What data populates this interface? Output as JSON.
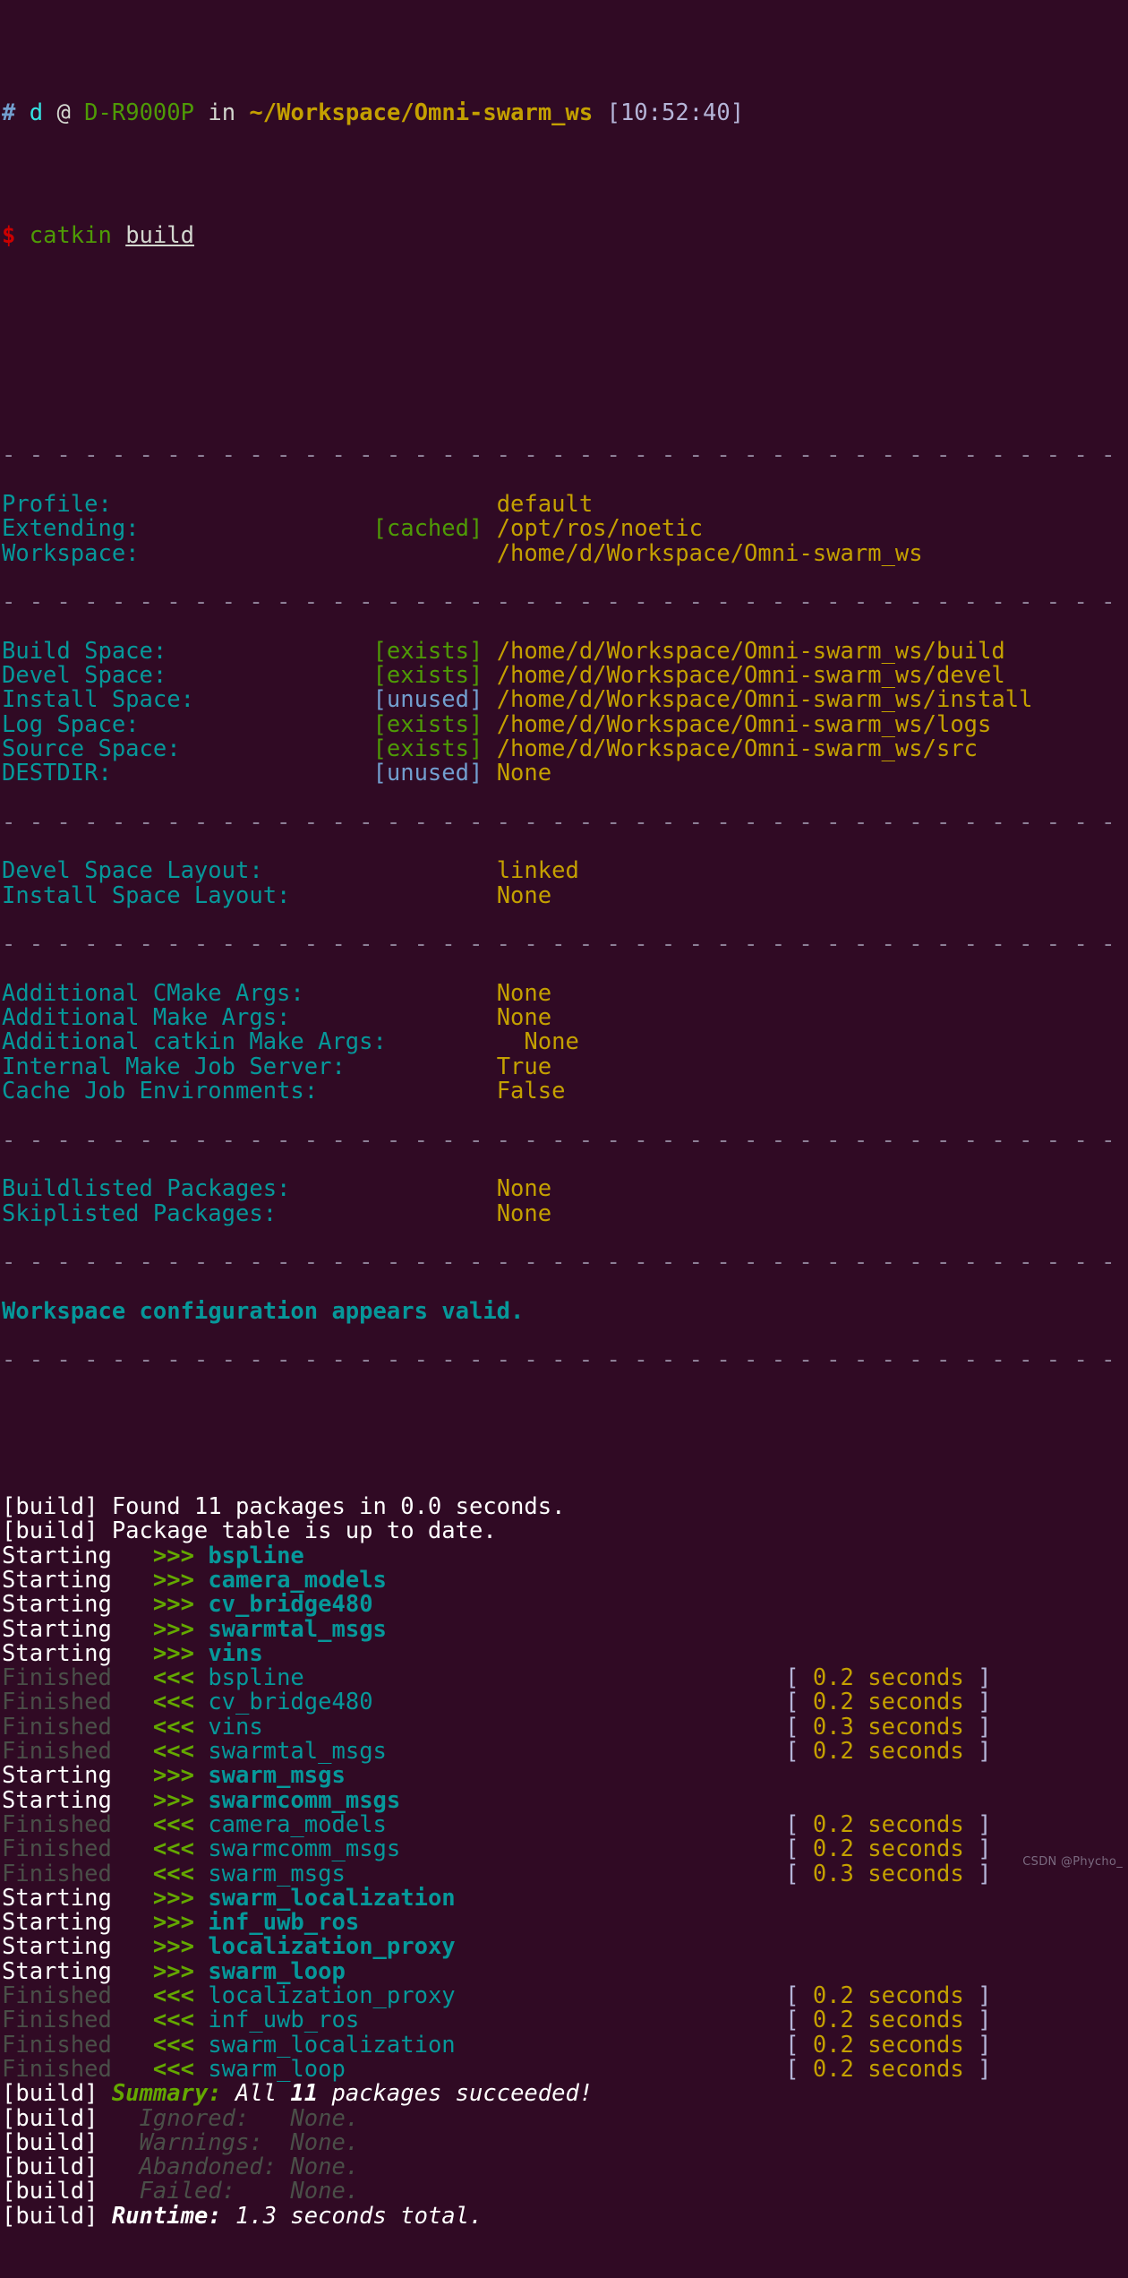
{
  "terminal": {
    "background_color": "#300a24",
    "prompt": {
      "hash": "#",
      "user": "d",
      "at": "@",
      "host": "D-R9000P",
      "in": "in",
      "path": "~/Workspace/Omni-swarm_ws",
      "time": "[10:52:40]",
      "dollar": "$",
      "command": "catkin",
      "argument": "build"
    },
    "separator": "- - - - - - - - - - - - - - - - - - - - - - - - - - - - - - - - - - - - - - - - - - - - - - -",
    "config_groups": [
      {
        "rows": [
          {
            "label": "Profile:",
            "status": "",
            "value": "default"
          },
          {
            "label": "Extending:",
            "status": "[cached]",
            "status_color": "green",
            "value": "/opt/ros/noetic"
          },
          {
            "label": "Workspace:",
            "status": "",
            "value": "/home/d/Workspace/Omni-swarm_ws"
          }
        ]
      },
      {
        "rows": [
          {
            "label": "Build Space:",
            "status": "[exists]",
            "status_color": "green",
            "value": "/home/d/Workspace/Omni-swarm_ws/build"
          },
          {
            "label": "Devel Space:",
            "status": "[exists]",
            "status_color": "green",
            "value": "/home/d/Workspace/Omni-swarm_ws/devel"
          },
          {
            "label": "Install Space:",
            "status": "[unused]",
            "status_color": "blue",
            "value": "/home/d/Workspace/Omni-swarm_ws/install"
          },
          {
            "label": "Log Space:",
            "status": "[exists]",
            "status_color": "green",
            "value": "/home/d/Workspace/Omni-swarm_ws/logs"
          },
          {
            "label": "Source Space:",
            "status": "[exists]",
            "status_color": "green",
            "value": "/home/d/Workspace/Omni-swarm_ws/src"
          },
          {
            "label": "DESTDIR:",
            "status": "[unused]",
            "status_color": "blue",
            "value": "None"
          }
        ]
      },
      {
        "rows": [
          {
            "label": "Devel Space Layout:",
            "status": "",
            "value": "linked"
          },
          {
            "label": "Install Space Layout:",
            "status": "",
            "value": "None"
          }
        ]
      },
      {
        "rows": [
          {
            "label": "Additional CMake Args:",
            "status": "",
            "value": "None"
          },
          {
            "label": "Additional Make Args:",
            "status": "",
            "value": "None"
          },
          {
            "label": "Additional catkin Make Args:",
            "status": "",
            "value": "None"
          },
          {
            "label": "Internal Make Job Server:",
            "status": "",
            "value": "True"
          },
          {
            "label": "Cache Job Environments:",
            "status": "",
            "value": "False"
          }
        ]
      },
      {
        "rows": [
          {
            "label": "Buildlisted Packages:",
            "status": "",
            "value": "None"
          },
          {
            "label": "Skiplisted Packages:",
            "status": "",
            "value": "None"
          }
        ]
      }
    ],
    "valid_message": "Workspace configuration appears valid.",
    "build_lines": [
      {
        "tag": "[build]",
        "text": " Found 11 packages in 0.0 seconds."
      },
      {
        "tag": "[build]",
        "text": " Package table is up to date."
      }
    ],
    "job_lines": [
      {
        "state": "Starting",
        "arrow": ">>>",
        "package": "bspline",
        "time": ""
      },
      {
        "state": "Starting",
        "arrow": ">>>",
        "package": "camera_models",
        "time": ""
      },
      {
        "state": "Starting",
        "arrow": ">>>",
        "package": "cv_bridge480",
        "time": ""
      },
      {
        "state": "Starting",
        "arrow": ">>>",
        "package": "swarmtal_msgs",
        "time": ""
      },
      {
        "state": "Starting",
        "arrow": ">>>",
        "package": "vins",
        "time": ""
      },
      {
        "state": "Finished",
        "arrow": "<<<",
        "package": "bspline",
        "time": "[ 0.2 seconds ]"
      },
      {
        "state": "Finished",
        "arrow": "<<<",
        "package": "cv_bridge480",
        "time": "[ 0.2 seconds ]"
      },
      {
        "state": "Finished",
        "arrow": "<<<",
        "package": "vins",
        "time": "[ 0.3 seconds ]"
      },
      {
        "state": "Finished",
        "arrow": "<<<",
        "package": "swarmtal_msgs",
        "time": "[ 0.2 seconds ]"
      },
      {
        "state": "Starting",
        "arrow": ">>>",
        "package": "swarm_msgs",
        "time": ""
      },
      {
        "state": "Starting",
        "arrow": ">>>",
        "package": "swarmcomm_msgs",
        "time": ""
      },
      {
        "state": "Finished",
        "arrow": "<<<",
        "package": "camera_models",
        "time": "[ 0.2 seconds ]"
      },
      {
        "state": "Finished",
        "arrow": "<<<",
        "package": "swarmcomm_msgs",
        "time": "[ 0.2 seconds ]"
      },
      {
        "state": "Finished",
        "arrow": "<<<",
        "package": "swarm_msgs",
        "time": "[ 0.3 seconds ]"
      },
      {
        "state": "Starting",
        "arrow": ">>>",
        "package": "swarm_localization",
        "time": ""
      },
      {
        "state": "Starting",
        "arrow": ">>>",
        "package": "inf_uwb_ros",
        "time": ""
      },
      {
        "state": "Starting",
        "arrow": ">>>",
        "package": "localization_proxy",
        "time": ""
      },
      {
        "state": "Starting",
        "arrow": ">>>",
        "package": "swarm_loop",
        "time": ""
      },
      {
        "state": "Finished",
        "arrow": "<<<",
        "package": "localization_proxy",
        "time": "[ 0.2 seconds ]"
      },
      {
        "state": "Finished",
        "arrow": "<<<",
        "package": "inf_uwb_ros",
        "time": "[ 0.2 seconds ]"
      },
      {
        "state": "Finished",
        "arrow": "<<<",
        "package": "swarm_localization",
        "time": "[ 0.2 seconds ]"
      },
      {
        "state": "Finished",
        "arrow": "<<<",
        "package": "swarm_loop",
        "time": "[ 0.2 seconds ]"
      }
    ],
    "summary": {
      "tag": "[build]",
      "label": "Summary:",
      "prefix": "All ",
      "count": "11",
      "suffix": " packages succeeded!",
      "rows": [
        {
          "tag": "[build]",
          "label": "Ignored:",
          "value": "None."
        },
        {
          "tag": "[build]",
          "label": "Warnings:",
          "value": "None."
        },
        {
          "tag": "[build]",
          "label": "Abandoned:",
          "value": "None."
        },
        {
          "tag": "[build]",
          "label": "Failed:",
          "value": "None."
        }
      ],
      "runtime_tag": "[build]",
      "runtime_label": "Runtime:",
      "runtime_value": "1.3 seconds total."
    },
    "watermark": "CSDN @Phycho_"
  }
}
